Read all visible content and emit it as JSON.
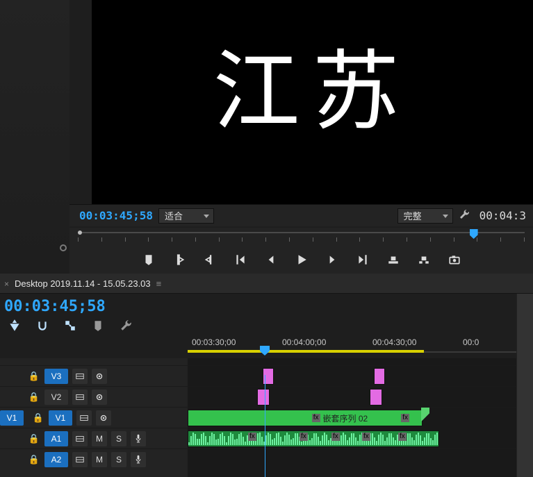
{
  "monitor": {
    "preview_text": "江苏",
    "timecode": "00:03:45;58",
    "fit_dropdown": "适合",
    "quality_dropdown": "完整",
    "right_timecode": "00:04:3"
  },
  "tab": {
    "close": "×",
    "title": "Desktop 2019.11.14 - 15.05.23.03",
    "menu_glyph": "≡"
  },
  "timeline": {
    "timecode": "00:03:45;58",
    "ruler_labels": [
      "00:03:30;00",
      "00:04:00;00",
      "00:04:30;00",
      "00:0"
    ],
    "source_patches": {
      "v": "V1",
      "a": "A1"
    },
    "video_tracks": [
      {
        "id": "V3",
        "selected": true
      },
      {
        "id": "V2",
        "selected": false
      },
      {
        "id": "V1",
        "selected": true
      }
    ],
    "audio_tracks": [
      {
        "id": "A1",
        "selected": true
      },
      {
        "id": "A2",
        "selected": true
      }
    ],
    "track_buttons": {
      "mute": "M",
      "solo": "S"
    },
    "nested_clip": {
      "fx": "fx",
      "label": "嵌套序列 02"
    }
  }
}
